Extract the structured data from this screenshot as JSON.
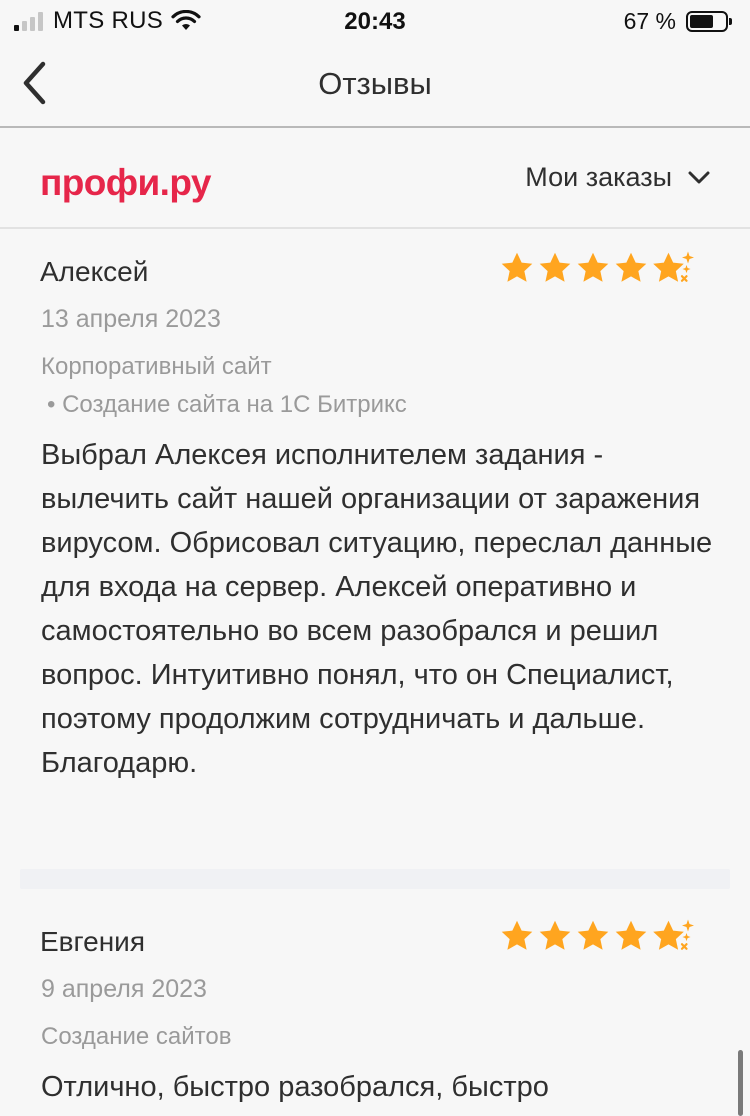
{
  "status_bar": {
    "carrier": "MTS RUS",
    "time": "20:43",
    "battery": "67 %",
    "battery_level": 0.67,
    "signal_bars_filled": 1,
    "icons": [
      "signal-icon",
      "wifi-icon",
      "battery-icon"
    ]
  },
  "nav": {
    "title": "Отзывы",
    "back_icon": "chevron-left-icon"
  },
  "brand": {
    "logo_text": "профи.ру",
    "logo_color": "#e6264a",
    "orders_label": "Мои заказы",
    "orders_icon": "chevron-down-icon"
  },
  "colors": {
    "star": "#ffa51f",
    "text_primary": "#2f2f2f",
    "text_secondary": "#9a9a9a",
    "background": "#f7f7f7"
  },
  "reviews": [
    {
      "name": "Алексей",
      "date": "13 апреля 2023",
      "rating": 5,
      "service": "Корпоративный сайт",
      "subservice": "• Создание сайта на 1С Битрикс",
      "text": "Выбрал Алексея исполнителем задания - вылечить сайт нашей организации от заражения вирусом. Обрисовал ситуацию, переслал данные для входа на сервер. Алексей оперативно и самостоятельно во всем разобрался и решил вопрос. Интуитивно понял, что он Специалист, поэтому продолжим сотрудничать и дальше. Благодарю."
    },
    {
      "name": "Евгения",
      "date": "9 апреля 2023",
      "rating": 5,
      "service": "Создание сайтов",
      "text": "Отлично, быстро разобрался, быстро"
    }
  ]
}
